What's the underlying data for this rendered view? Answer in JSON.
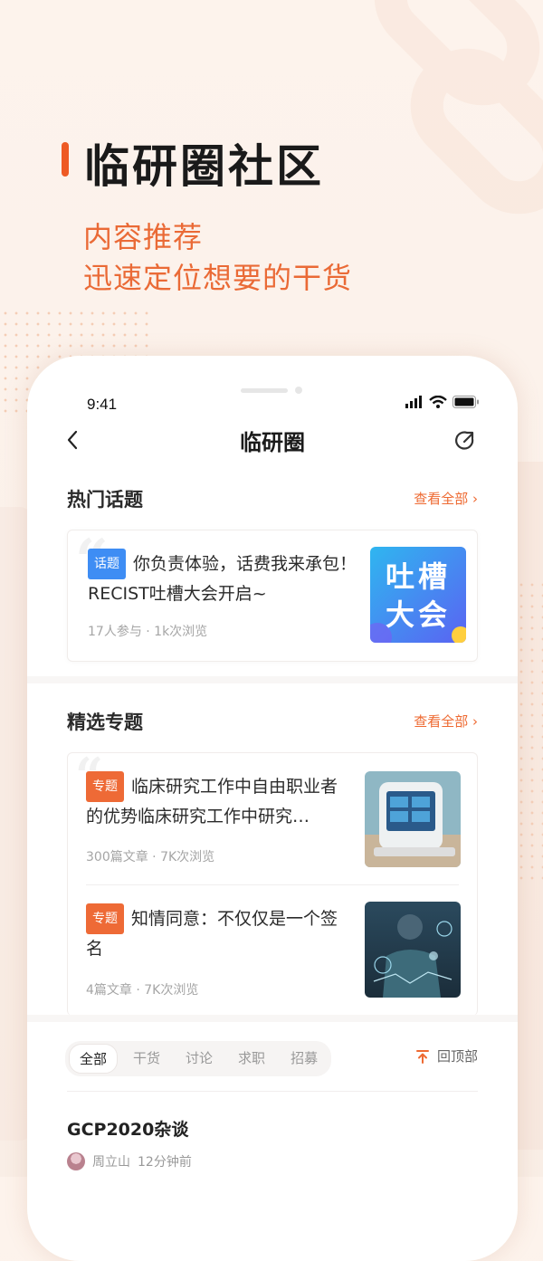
{
  "hero": {
    "title": "临研圈社区",
    "subtitle_line1": "内容推荐",
    "subtitle_line2": "迅速定位想要的干货",
    "accent_color": "#ee5a24"
  },
  "status_bar": {
    "time": "9:41",
    "icons": [
      "signal-icon",
      "wifi-icon",
      "battery-icon"
    ]
  },
  "nav": {
    "back_icon": "chevron-left-icon",
    "title": "临研圈",
    "share_icon": "share-icon"
  },
  "hot_topics": {
    "title": "热门话题",
    "more_label": "查看全部 ›",
    "items": [
      {
        "tag": "话题",
        "title": "你负责体验，话费我来承包！RECIST吐槽大会开启~",
        "meta": "17人参与 · 1k次浏览",
        "thumb_text_line1": "吐槽",
        "thumb_text_line2": "大会"
      }
    ]
  },
  "featured": {
    "title": "精选专题",
    "more_label": "查看全部 ›",
    "items": [
      {
        "tag": "专题",
        "title": "临床研究工作中自由职业者的优势临床研究工作中研究…",
        "meta": "300篇文章 · 7K次浏览"
      },
      {
        "tag": "专题",
        "title": "知情同意：不仅仅是一个签名",
        "meta": "4篇文章 · 7K次浏览"
      }
    ]
  },
  "filter_tabs": {
    "items": [
      "全部",
      "干货",
      "讨论",
      "求职",
      "招募"
    ],
    "active": "全部",
    "back_to_top": "回顶部"
  },
  "post": {
    "title": "GCP2020杂谈",
    "author": "周立山",
    "time": "12分钟前"
  }
}
